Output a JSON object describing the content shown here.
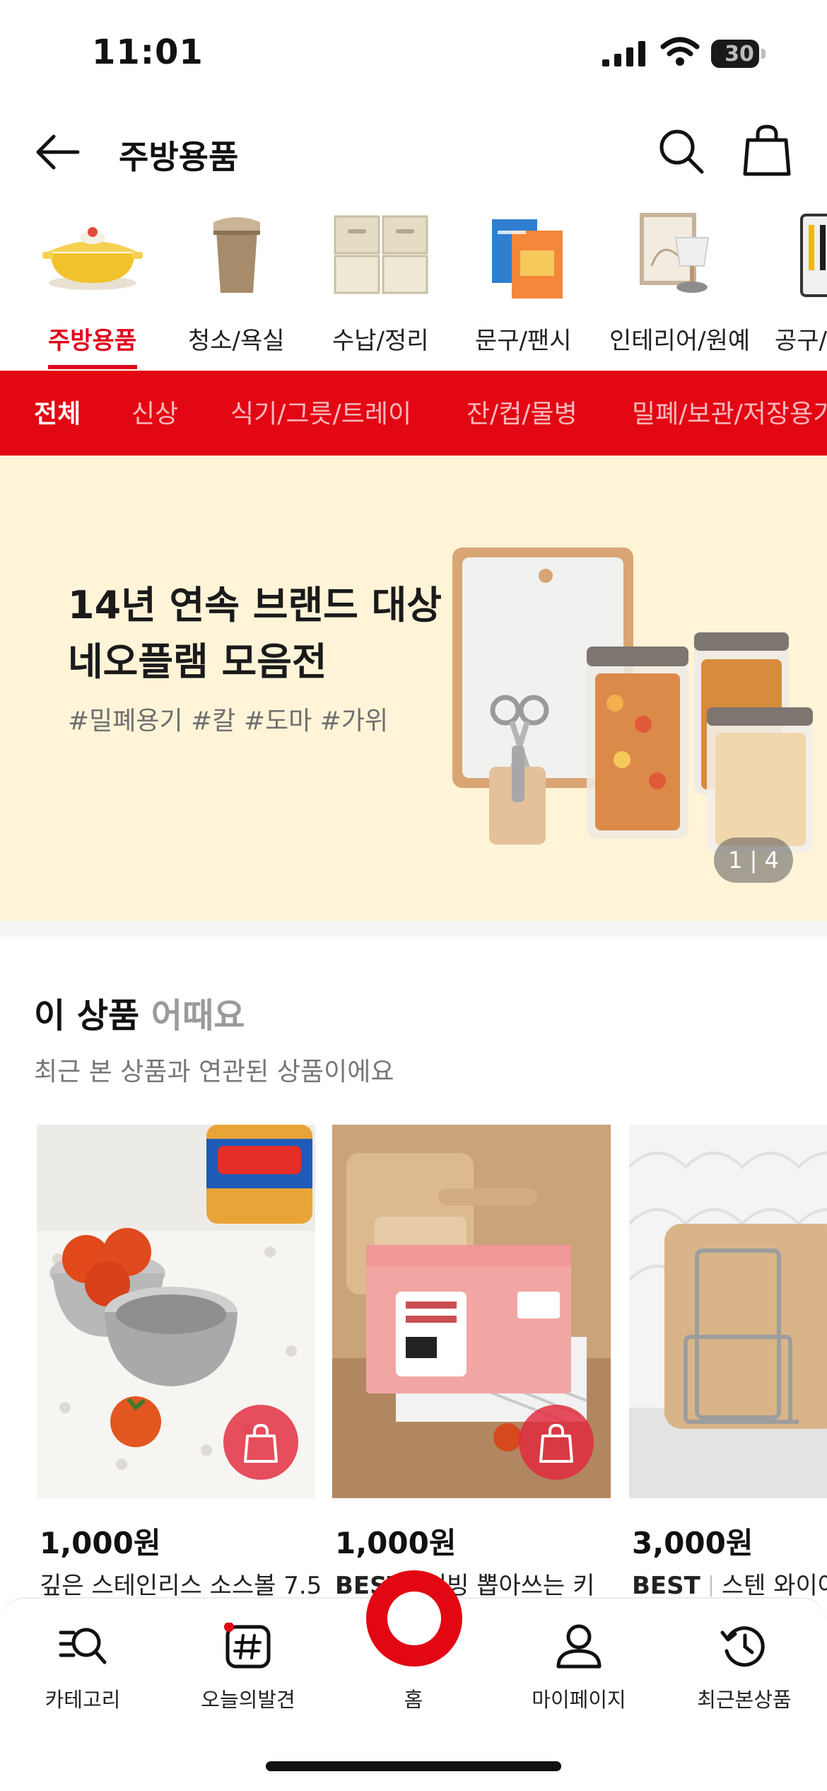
{
  "status_bar": {
    "time": "11:01",
    "battery": "30"
  },
  "header": {
    "title": "주방용품"
  },
  "categories": [
    {
      "label": "주방용품",
      "icon": "casserole-pot-icon",
      "active": true
    },
    {
      "label": "청소/욕실",
      "icon": "trash-bin-icon",
      "active": false
    },
    {
      "label": "수납/정리",
      "icon": "storage-box-icon",
      "active": false
    },
    {
      "label": "문구/팬시",
      "icon": "notebook-icon",
      "active": false
    },
    {
      "label": "인테리어/원예",
      "icon": "lamp-frame-icon",
      "active": false
    },
    {
      "label": "공구/",
      "icon": "tool-set-icon",
      "active": false
    }
  ],
  "filters": [
    {
      "label": "전체",
      "active": true
    },
    {
      "label": "신상",
      "active": false
    },
    {
      "label": "식기/그릇/트레이",
      "active": false
    },
    {
      "label": "잔/컵/물병",
      "active": false
    },
    {
      "label": "밀폐/보관/저장용기",
      "active": false
    }
  ],
  "banner": {
    "title_line1": "14년 연속 브랜드 대상",
    "title_line2": "네오플램 모음전",
    "tags": "#밀폐용기 #칼 #도마 #가위",
    "pager": "1 | 4"
  },
  "recommend": {
    "title_main": "이 상품",
    "title_muted": "어때요",
    "subtitle": "최근 본 상품과 연관된 상품이에요",
    "products": [
      {
        "price": "1,000원",
        "badge": "",
        "name": "깊은 스테인리스 소스볼 7.5"
      },
      {
        "price": "1,000원",
        "badge": "BEST",
        "name": "리빙 뽑아쓰는 키"
      },
      {
        "price": "3,000원",
        "badge": "BEST",
        "name": "스텐 와이어"
      }
    ]
  },
  "bottom_nav": [
    {
      "label": "카테고리",
      "icon": "category-search-icon"
    },
    {
      "label": "오늘의발견",
      "icon": "hashtag-icon"
    },
    {
      "label": "홈",
      "icon": "home-ring-icon"
    },
    {
      "label": "마이페이지",
      "icon": "person-icon"
    },
    {
      "label": "최근본상품",
      "icon": "history-clock-icon"
    }
  ],
  "colors": {
    "accent": "#e30613",
    "banner_bg": "#fff4d8"
  }
}
